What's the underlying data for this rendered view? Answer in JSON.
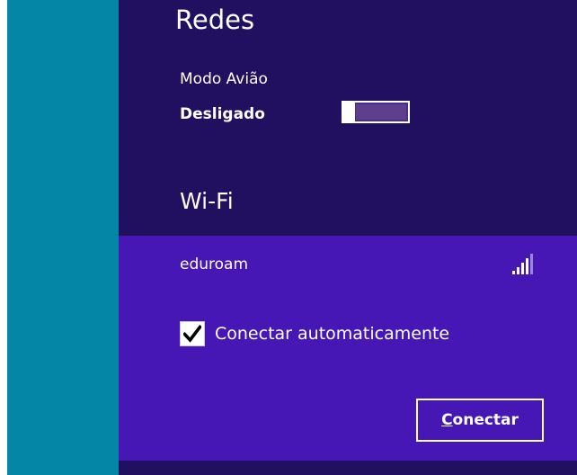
{
  "colors": {
    "accent_strip": "#0487a6",
    "panel_background": "#20105f",
    "selected_network_background": "#4617b4",
    "text": "#ffffff"
  },
  "panel": {
    "title": "Redes"
  },
  "airplane_mode": {
    "label": "Modo Avião",
    "state_label": "Desligado",
    "enabled": false
  },
  "wifi": {
    "section_title": "Wi-Fi",
    "networks": [
      {
        "name": "eduroam",
        "signal_icon": "wifi-signal-icon",
        "signal_bars": 4,
        "auto_connect_label": "Conectar automaticamente",
        "auto_connect_checked": true,
        "connect_button": {
          "label_prefix": "",
          "label_mnemonic": "C",
          "label_rest": "onectar"
        }
      }
    ]
  }
}
